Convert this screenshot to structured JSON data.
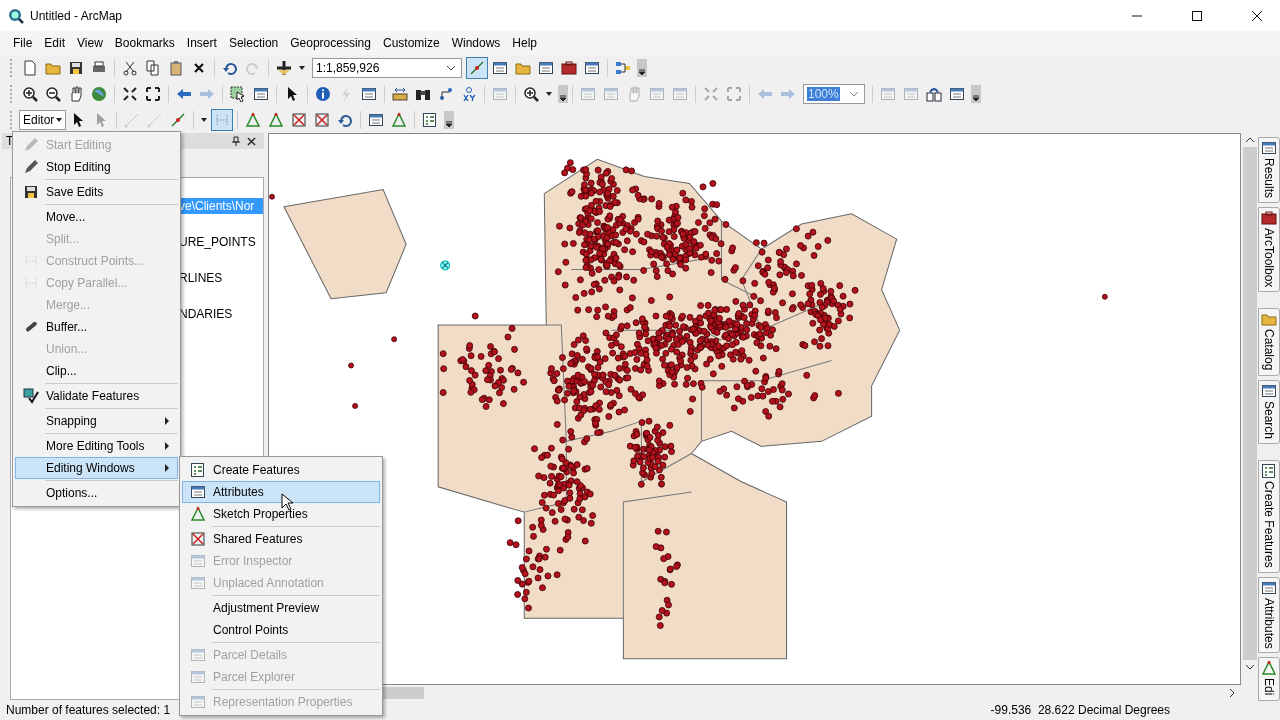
{
  "window": {
    "title": "Untitled - ArcMap"
  },
  "menu_bar": [
    "File",
    "Edit",
    "View",
    "Bookmarks",
    "Insert",
    "Selection",
    "Geoprocessing",
    "Customize",
    "Windows",
    "Help"
  ],
  "toolbar": {
    "scale": "1:1,859,926",
    "layout_zoom": "100%",
    "editor_label": "Editor"
  },
  "table_of_contents": {
    "title": "T",
    "layers": [
      {
        "label": "ve\\Clients\\Nor",
        "selected": true
      },
      {
        "label": "URE_POINTS",
        "selected": false
      },
      {
        "label": "RLINES",
        "selected": false
      },
      {
        "label": "NDARIES",
        "selected": false
      }
    ]
  },
  "editor_menu": {
    "items": [
      {
        "kind": "item",
        "label": "Start Editing",
        "disabled": true,
        "selected": false
      },
      {
        "kind": "item",
        "label": "Stop Editing",
        "disabled": false,
        "selected": false
      },
      {
        "kind": "separator"
      },
      {
        "kind": "item",
        "label": "Save Edits",
        "disabled": false,
        "selected": false
      },
      {
        "kind": "separator"
      },
      {
        "kind": "item",
        "label": "Move...",
        "disabled": false,
        "selected": false
      },
      {
        "kind": "item",
        "label": "Split...",
        "disabled": true,
        "selected": false
      },
      {
        "kind": "item",
        "label": "Construct Points...",
        "disabled": true,
        "selected": false
      },
      {
        "kind": "item",
        "label": "Copy Parallel...",
        "disabled": true,
        "selected": false
      },
      {
        "kind": "item",
        "label": "Merge...",
        "disabled": true,
        "selected": false
      },
      {
        "kind": "item",
        "label": "Buffer...",
        "disabled": false,
        "selected": false
      },
      {
        "kind": "item",
        "label": "Union...",
        "disabled": true,
        "selected": false
      },
      {
        "kind": "item",
        "label": "Clip...",
        "disabled": false,
        "selected": false
      },
      {
        "kind": "separator"
      },
      {
        "kind": "item",
        "label": "Validate Features",
        "disabled": false,
        "selected": false
      },
      {
        "kind": "separator"
      },
      {
        "kind": "submenu",
        "label": "Snapping",
        "disabled": false,
        "selected": false
      },
      {
        "kind": "separator"
      },
      {
        "kind": "submenu",
        "label": "More Editing Tools",
        "disabled": false,
        "selected": false
      },
      {
        "kind": "submenu",
        "label": "Editing Windows",
        "disabled": false,
        "selected": true
      },
      {
        "kind": "separator"
      },
      {
        "kind": "item",
        "label": "Options...",
        "disabled": false,
        "selected": false
      }
    ]
  },
  "editing_windows_submenu": {
    "items": [
      {
        "kind": "item",
        "label": "Create Features",
        "disabled": false,
        "selected": false
      },
      {
        "kind": "item",
        "label": "Attributes",
        "disabled": false,
        "selected": true
      },
      {
        "kind": "item",
        "label": "Sketch Properties",
        "disabled": false,
        "selected": false
      },
      {
        "kind": "separator"
      },
      {
        "kind": "item",
        "label": "Shared Features",
        "disabled": false,
        "selected": false
      },
      {
        "kind": "item",
        "label": "Error Inspector",
        "disabled": true,
        "selected": false
      },
      {
        "kind": "item",
        "label": "Unplaced Annotation",
        "disabled": true,
        "selected": false
      },
      {
        "kind": "separator"
      },
      {
        "kind": "item",
        "label": "Adjustment Preview",
        "disabled": false,
        "selected": false
      },
      {
        "kind": "item",
        "label": "Control Points",
        "disabled": false,
        "selected": false
      },
      {
        "kind": "separator"
      },
      {
        "kind": "item",
        "label": "Parcel Details",
        "disabled": true,
        "selected": false
      },
      {
        "kind": "item",
        "label": "Parcel Explorer",
        "disabled": true,
        "selected": false
      },
      {
        "kind": "separator"
      },
      {
        "kind": "item",
        "label": "Representation Properties",
        "disabled": true,
        "selected": false
      }
    ]
  },
  "side_tabs": [
    "Results",
    "ArcToolbox",
    "Catalog",
    "Search",
    "Create Features",
    "Attributes",
    "Edi"
  ],
  "status_bar": {
    "selection": "Number of features selected: 1",
    "coordinates": "-99.536  28.622 Decimal Degrees"
  }
}
